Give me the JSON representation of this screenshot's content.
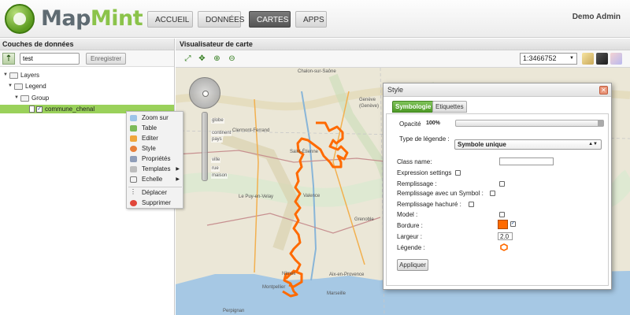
{
  "app": {
    "brand_main": "Map",
    "brand_accent": "Mint",
    "colors": {
      "accent": "#8bc34a",
      "selection": "#9ad15a",
      "route": "#ff6a00"
    }
  },
  "nav": {
    "items": [
      {
        "label": "ACCUEIL",
        "active": false
      },
      {
        "label": "DONNÉES",
        "active": false
      },
      {
        "label": "CARTES",
        "active": true
      },
      {
        "label": "APPS",
        "active": false
      }
    ],
    "user": "Demo Admin"
  },
  "layers_panel": {
    "title": "Couches de données",
    "map_name_value": "test",
    "save_label": "Enregistrer",
    "tree": [
      {
        "label": "Layers"
      },
      {
        "label": "Legend"
      },
      {
        "label": "Group"
      },
      {
        "label": "commune_chenal",
        "checked": true,
        "selected": true
      }
    ]
  },
  "context_menu": {
    "items": [
      {
        "label": "Zoom sur",
        "icon": "zoom-icon"
      },
      {
        "label": "Table",
        "icon": "table-icon"
      },
      {
        "label": "Editer",
        "icon": "pencil-icon"
      },
      {
        "label": "Style",
        "icon": "palette-icon"
      },
      {
        "label": "Propriétés",
        "icon": "wrench-icon"
      },
      {
        "label": "Templates",
        "icon": "template-icon",
        "submenu": true
      },
      {
        "label": "Echelle",
        "icon": "scale-icon",
        "submenu": true
      },
      {
        "label": "Déplacer",
        "icon": "move-icon"
      },
      {
        "label": "Supprimer",
        "icon": "delete-icon"
      }
    ]
  },
  "map_panel": {
    "title": "Visualisateur de carte",
    "scale": "1:3466752",
    "zoom_levels": [
      "globe",
      "continent",
      "pays",
      "ville",
      "rue",
      "maison"
    ],
    "place_labels": [
      "Chalon-sur-Saône",
      "Genève",
      "(Genève)",
      "Clermont-Ferrand",
      "Saint-Étienne",
      "Le Puy-en-Velay",
      "Valence",
      "Montpellier",
      "Nîmes",
      "Aix-en-Provence",
      "Marseille",
      "Perpignan",
      "Grenoble"
    ]
  },
  "style_dialog": {
    "title": "Style",
    "tabs": [
      "Symbologie",
      "Etiquettes"
    ],
    "opacity_label": "Opacité",
    "opacity_value": "100%",
    "opacity_fraction": 1.0,
    "legend_type_label": "Type de légende :",
    "legend_type_value": "Symbole unique",
    "class_name_label": "Class name:",
    "class_name_value": "",
    "expression_label": "Expression settings",
    "fill_label": "Remplissage :",
    "fill_symbol_label": "Remplissage avec un Symbol :",
    "hatched_fill_label": "Remplissage hachuré :",
    "model_label": "Model :",
    "border_label": "Bordure :",
    "border_color": "#ff6a00",
    "border_checked": true,
    "width_label": "Largeur :",
    "width_value": "2.0",
    "legend_label": "Légende :",
    "apply_label": "Appliquer"
  }
}
